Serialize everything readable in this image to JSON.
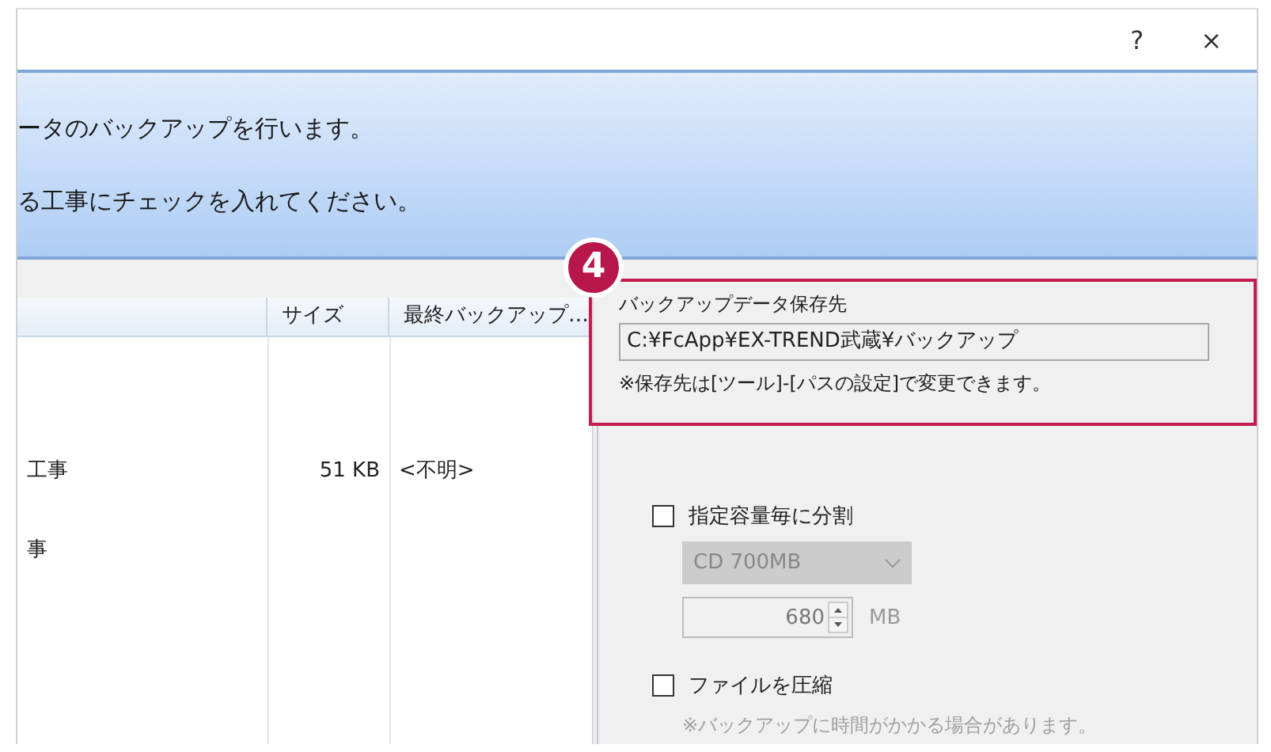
{
  "window": {
    "help_button": "?",
    "close_button": "×"
  },
  "banner": {
    "lines": [
      "ータのバックアップを行います。",
      "る工事にチェックを入れてください。"
    ]
  },
  "list": {
    "columns": [
      "サイズ",
      "最終バックアップ…"
    ],
    "rows": [
      {
        "name": "工事",
        "size": "51 KB",
        "last_backup": "<不明>"
      },
      {
        "name": "事"
      }
    ]
  },
  "backup_destination": {
    "label": "バックアップデータ保存先",
    "path": "C:¥FcApp¥EX-TREND武蔵¥バックアップ",
    "note": "※保存先は[ツール]-[パスの設定]で変更できます。"
  },
  "annotation": {
    "number": "4"
  },
  "options": [
    {
      "kind": "checkbox",
      "label": "指定容量毎に分割",
      "checked": false
    },
    {
      "kind": "select",
      "value": "CD 700MB",
      "disabled": true
    },
    {
      "kind": "spin",
      "value": "680",
      "unit": "MB",
      "disabled": true
    },
    {
      "kind": "checkbox",
      "label": "ファイルを圧縮",
      "checked": false
    },
    {
      "kind": "note",
      "text": "※バックアップに時間がかかる場合があります。"
    }
  ]
}
